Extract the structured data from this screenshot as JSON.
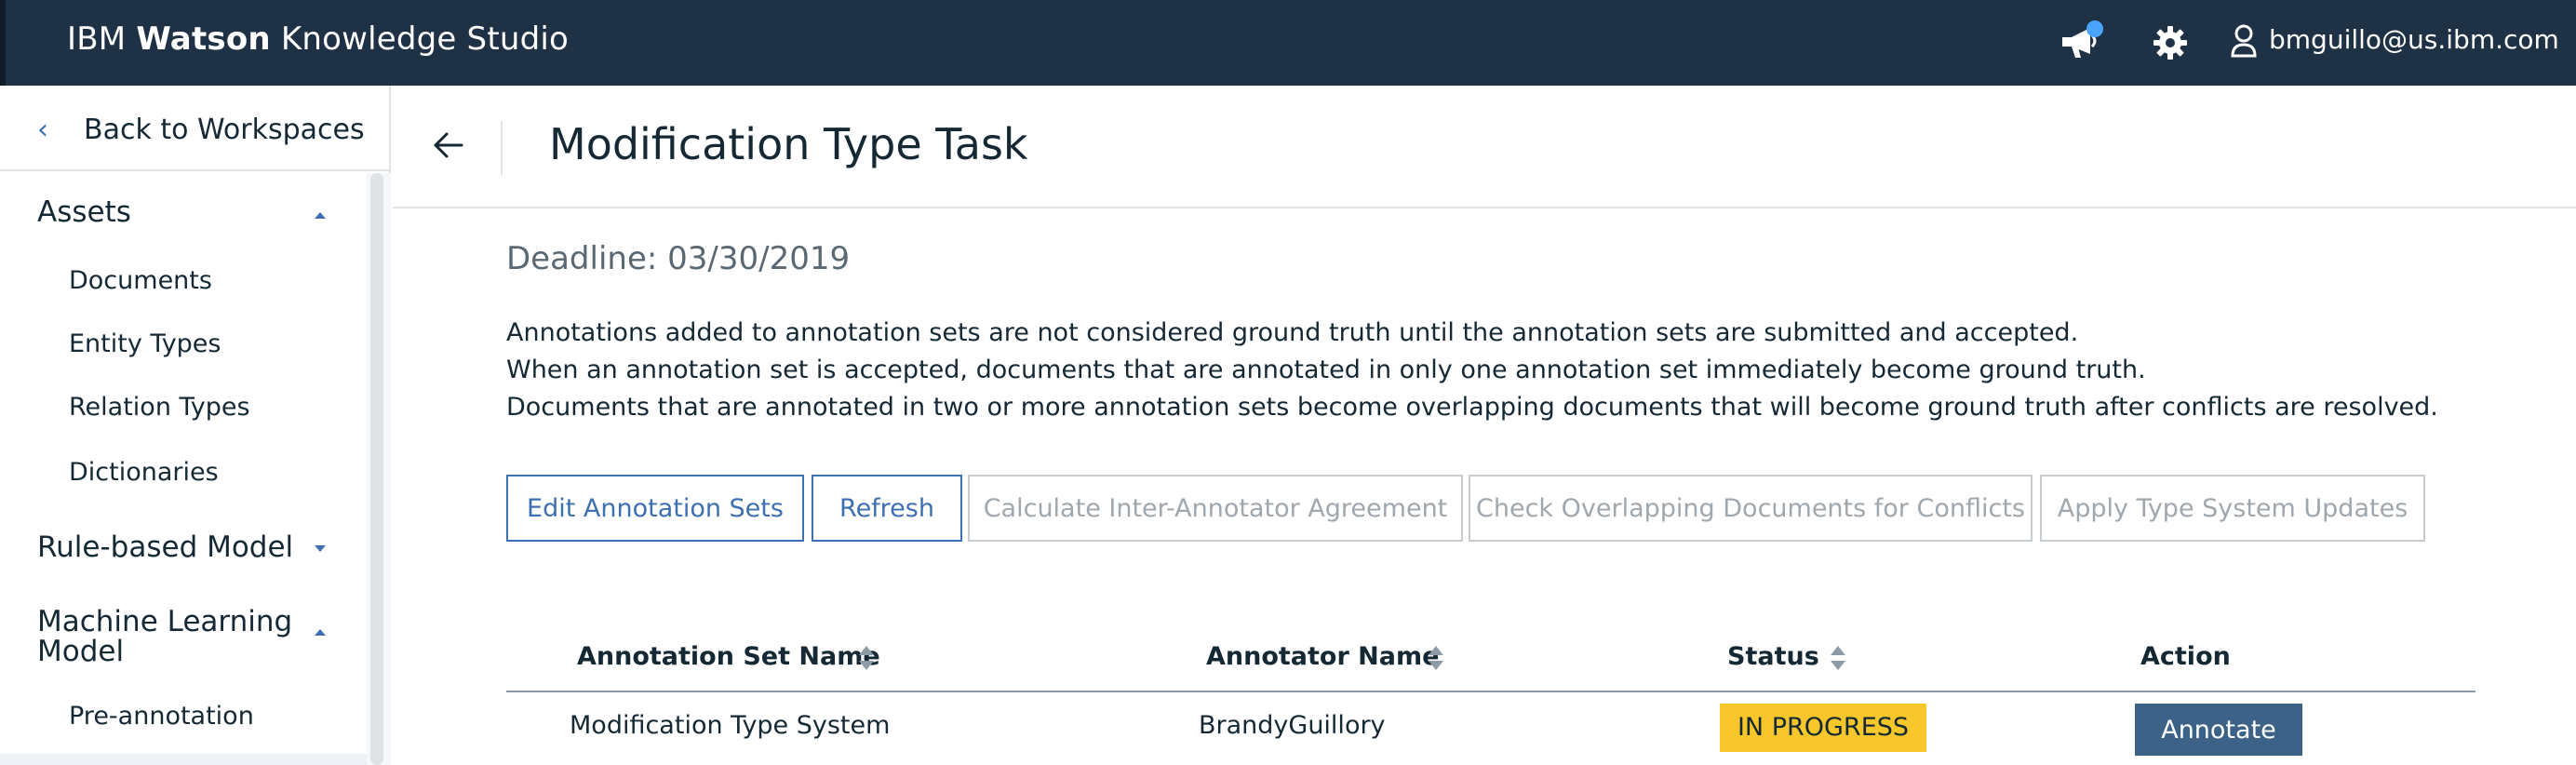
{
  "header": {
    "brand_prefix": "IBM",
    "brand_bold": "Watson",
    "brand_suffix": "Knowledge Studio",
    "user_email": "bmguillo@us.ibm.com",
    "notification_badge_color": "#4aa3ff",
    "icons": [
      "megaphone-icon",
      "gear-icon",
      "user-icon"
    ]
  },
  "sidebar": {
    "back_label": "Back to Workspaces",
    "sections": [
      {
        "label": "Assets",
        "expanded": true,
        "items": [
          "Documents",
          "Entity Types",
          "Relation Types",
          "Dictionaries"
        ]
      },
      {
        "label": "Rule-based Model",
        "expanded": false,
        "items": []
      },
      {
        "label_line1": "Machine Learning",
        "label_line2": "Model",
        "expanded": true,
        "items": [
          "Pre-annotation"
        ]
      }
    ]
  },
  "main": {
    "title": "Modification Type Task",
    "deadline": "Deadline: 03/30/2019",
    "description": [
      "Annotations added to annotation sets are not considered ground truth until the annotation sets are submitted and accepted.",
      "When an annotation set is accepted, documents that are annotated in only one annotation set immediately become ground truth.",
      "Documents that are annotated in two or more annotation sets become overlapping documents that will become ground truth after conflicts are resolved."
    ],
    "buttons": [
      {
        "label": "Edit Annotation Sets",
        "enabled": true
      },
      {
        "label": "Refresh",
        "enabled": true
      },
      {
        "label": "Calculate Inter-Annotator Agreement",
        "enabled": false
      },
      {
        "label": "Check Overlapping Documents for Conflicts",
        "enabled": false
      },
      {
        "label": "Apply Type System Updates",
        "enabled": false
      }
    ],
    "table": {
      "columns": [
        "Annotation Set Name",
        "Annotator Name",
        "Status",
        "Action"
      ],
      "rows": [
        {
          "annotation_set_name": "Modification Type System",
          "annotator_name": "BrandyGuillory",
          "status": "IN PROGRESS",
          "action": "Annotate"
        }
      ]
    }
  },
  "colors": {
    "topbar": "#1f3144",
    "accent": "#3d70b2",
    "status_in_progress": "#f7c62b",
    "annotate_button": "#3d6287"
  }
}
